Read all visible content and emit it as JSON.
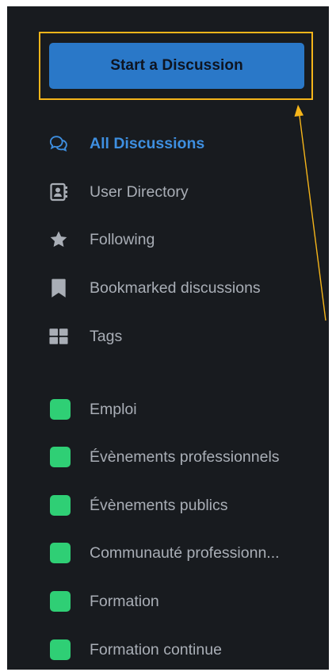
{
  "cta": {
    "label": "Start a Discussion"
  },
  "nav": {
    "items": [
      {
        "label": "All Discussions",
        "icon": "comments-icon",
        "active": true
      },
      {
        "label": "User Directory",
        "icon": "address-card-icon",
        "active": false
      },
      {
        "label": "Following",
        "icon": "star-icon",
        "active": false
      },
      {
        "label": "Bookmarked discussions",
        "icon": "bookmark-icon",
        "active": false
      },
      {
        "label": "Tags",
        "icon": "grid-icon",
        "active": false
      }
    ]
  },
  "tags": [
    {
      "label": "Emploi"
    },
    {
      "label": "Évènements professionnels"
    },
    {
      "label": "Évènements publics"
    },
    {
      "label": "Communauté professionn..."
    },
    {
      "label": "Formation"
    },
    {
      "label": "Formation continue"
    }
  ],
  "colors": {
    "background": "#181b1f",
    "primary": "#2a78c8",
    "active_text": "#3e8fe0",
    "muted_text": "#a9aeb6",
    "tag_green": "#2fcf75",
    "highlight": "#f5b51a"
  }
}
